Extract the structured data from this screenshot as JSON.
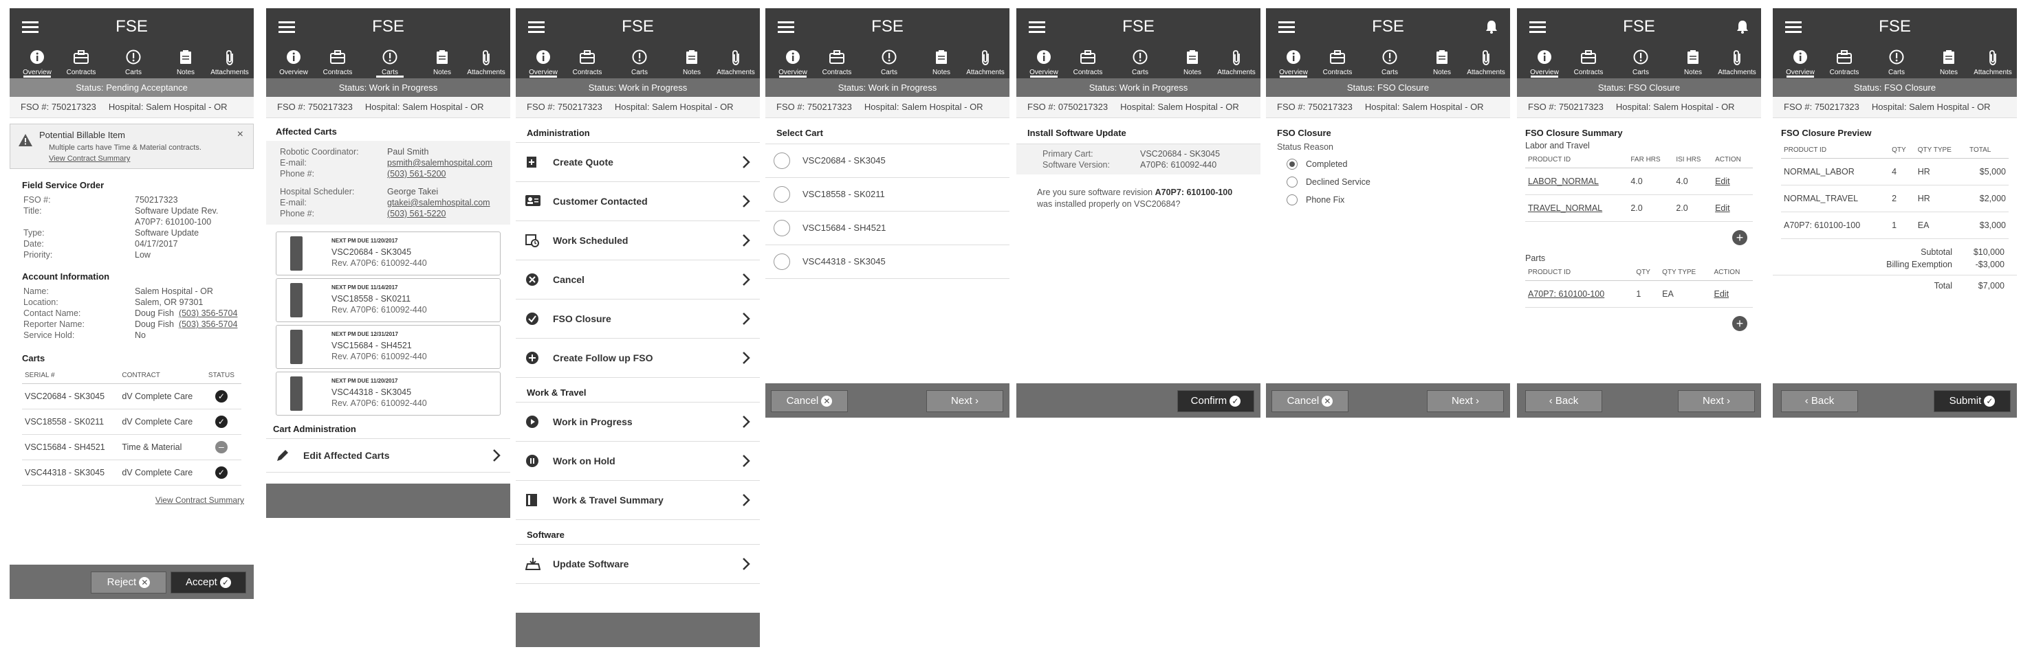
{
  "app_title": "FSE",
  "nav": [
    "Overview",
    "Contracts",
    "Carts",
    "Notes",
    "Attachments"
  ],
  "fso_label": "FSO #:",
  "hospital_label": "Hospital:",
  "hospital": "Salem Hospital - OR",
  "fso_number": "750217323",
  "fso_number_alt": "0750217323",
  "s1": {
    "status": "Status: Pending Acceptance",
    "alert_title": "Potential Billable Item",
    "alert_body": "Multiple carts have Time & Material contracts.",
    "alert_link": "View Contract Summary",
    "order_title": "Field Service Order",
    "order": [
      {
        "k": "FSO #:",
        "v": "750217323"
      },
      {
        "k": "Title:",
        "v": "Software Update Rev."
      },
      {
        "k": "",
        "v": "A70P7: 610100-100"
      },
      {
        "k": "Type:",
        "v": "Software Update"
      },
      {
        "k": "Date:",
        "v": "04/17/2017"
      },
      {
        "k": "Priority:",
        "v": "Low"
      }
    ],
    "account_title": "Account Information",
    "account": {
      "name_k": "Name:",
      "name_v": "Salem Hospital - OR",
      "loc_k": "Location:",
      "loc_v": "Salem, OR 97301",
      "contact_k": "Contact Name:",
      "contact_v": "Doug Fish",
      "contact_phone": "(503) 356-5704",
      "reporter_k": "Reporter Name:",
      "reporter_v": "Doug Fish",
      "reporter_phone": "(503) 356-5704",
      "hold_k": "Service Hold:",
      "hold_v": "No"
    },
    "carts_title": "Carts",
    "carts_headers": [
      "SERIAL #",
      "CONTRACT",
      "STATUS"
    ],
    "carts": [
      {
        "serial": "VSC20684 - SK3045",
        "contract": "dV Complete Care",
        "status": "check"
      },
      {
        "serial": "VSC18558 - SK0211",
        "contract": "dV Complete Care",
        "status": "check"
      },
      {
        "serial": "VSC15684 - SH4521",
        "contract": "Time & Material",
        "status": "minus"
      },
      {
        "serial": "VSC44318 - SK3045",
        "contract": "dV Complete Care",
        "status": "check"
      }
    ],
    "summary_link": "View Contract Summary",
    "reject": "Reject",
    "accept": "Accept"
  },
  "s2": {
    "status": "Status: Work in Progress",
    "affected_title": "Affected Carts",
    "coord_k": "Robotic Coordinator:",
    "coord_v": "Paul Smith",
    "email_k": "E-mail:",
    "coord_email": "psmith@salemhospital.com",
    "phone_k": "Phone #:",
    "coord_phone": "(503) 561-5200",
    "sched_k": "Hospital Scheduler:",
    "sched_v": "George Takei",
    "sched_email": "gtakei@salemhospital.com",
    "sched_phone": "(503) 561-5220",
    "cards": [
      {
        "due": "NEXT PM DUE 11/20/2017",
        "serial": "VSC20684 - SK3045",
        "rev": "Rev. A70P6: 610092-440"
      },
      {
        "due": "NEXT PM DUE 11/14/2017",
        "serial": "VSC18558 - SK0211",
        "rev": "Rev. A70P6: 610092-440"
      },
      {
        "due": "NEXT PM DUE 12/31/2017",
        "serial": "VSC15684 - SH4521",
        "rev": "Rev. A70P6: 610092-440"
      },
      {
        "due": "NEXT PM DUE 11/20/2017",
        "serial": "VSC44318 - SK3045",
        "rev": "Rev. A70P6: 610092-440"
      }
    ],
    "cart_admin": "Cart Administration",
    "edit_carts": "Edit Affected Carts"
  },
  "s3": {
    "status": "Status: Work in Progress",
    "admin_title": "Administration",
    "admin_items": [
      "Create Quote",
      "Customer Contacted",
      "Work Scheduled",
      "Cancel",
      "FSO Closure",
      "Create Follow up FSO"
    ],
    "wt_title": "Work & Travel",
    "wt_items": [
      "Work in Progress",
      "Work on Hold",
      "Work & Travel Summary"
    ],
    "sw_title": "Software",
    "sw_items": [
      "Update Software"
    ]
  },
  "s4": {
    "status": "Status: Work in Progress",
    "select_title": "Select Cart",
    "carts": [
      "VSC20684 - SK3045",
      "VSC18558 - SK0211",
      "VSC15684 - SH4521",
      "VSC44318 - SK3045"
    ],
    "cancel": "Cancel",
    "next": "Next"
  },
  "s5": {
    "status": "Status: Work in Progress",
    "install_title": "Install Software Update",
    "primary_k": "Primary Cart:",
    "primary_v": "VSC20684 - SK3045",
    "version_k": "Software Version:",
    "version_v": "A70P6: 610092-440",
    "q1": "Are you sure software revision",
    "q_rev": "A70P7: 610100-100",
    "q2": "was installed properly on VSC20684?",
    "confirm": "Confirm"
  },
  "s6": {
    "status": "Status: FSO Closure",
    "closure_title": "FSO Closure",
    "reason_title": "Status Reason",
    "options": [
      "Completed",
      "Declined Service",
      "Phone Fix"
    ],
    "selected": "Completed",
    "cancel": "Cancel",
    "next": "Next"
  },
  "s7": {
    "status": "Status: FSO Closure",
    "summary_title": "FSO Closure Summary",
    "lt_title": "Labor and Travel",
    "lt_headers": [
      "PRODUCT ID",
      "FAR HRS",
      "ISI HRS",
      "ACTION"
    ],
    "lt_rows": [
      {
        "id": "LABOR_NORMAL",
        "far": "4.0",
        "isi": "4.0",
        "action": "Edit"
      },
      {
        "id": "TRAVEL_NORMAL",
        "far": "2.0",
        "isi": "2.0",
        "action": "Edit"
      }
    ],
    "parts_title": "Parts",
    "parts_headers": [
      "PRODUCT ID",
      "QTY",
      "QTY TYPE",
      "ACTION"
    ],
    "parts_rows": [
      {
        "id": "A70P7: 610100-100",
        "qty": "1",
        "type": "EA",
        "action": "Edit"
      }
    ],
    "back": "Back",
    "next": "Next"
  },
  "s8": {
    "status": "Status: FSO Closure",
    "preview_title": "FSO Closure Preview",
    "headers": [
      "PRODUCT ID",
      "QTY",
      "QTY TYPE",
      "TOTAL"
    ],
    "rows": [
      {
        "id": "NORMAL_LABOR",
        "qty": "4",
        "type": "HR",
        "total": "$5,000"
      },
      {
        "id": "NORMAL_TRAVEL",
        "qty": "2",
        "type": "HR",
        "total": "$2,000"
      },
      {
        "id": "A70P7: 610100-100",
        "qty": "1",
        "type": "EA",
        "total": "$3,000"
      }
    ],
    "subtotal_k": "Subtotal",
    "subtotal_v": "$10,000",
    "billing_k": "Billing Exemption",
    "billing_v": "-$3,000",
    "total_k": "Total",
    "total_v": "$7,000",
    "back": "Back",
    "submit": "Submit"
  }
}
